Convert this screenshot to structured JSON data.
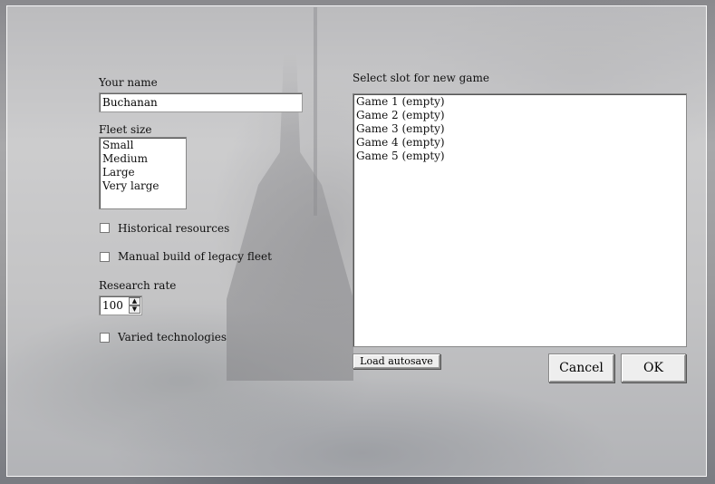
{
  "form": {
    "name_label": "Your name",
    "name_value": "Buchanan",
    "fleet_size_label": "Fleet size",
    "fleet_sizes": [
      "Small",
      "Medium",
      "Large",
      "Very large"
    ],
    "historical_resources_label": "Historical resources",
    "historical_resources_checked": false,
    "manual_build_label": "Manual build of legacy fleet",
    "manual_build_checked": false,
    "research_rate_label": "Research rate",
    "research_rate_value": "100",
    "varied_tech_label": "Varied technologies",
    "varied_tech_checked": false
  },
  "slots": {
    "label": "Select slot for new game",
    "items": [
      "Game 1 (empty)",
      "Game 2 (empty)",
      "Game 3 (empty)",
      "Game 4 (empty)",
      "Game 5 (empty)"
    ]
  },
  "buttons": {
    "load_autosave": "Load autosave",
    "cancel": "Cancel",
    "ok": "OK"
  },
  "icons": {
    "spin_up": "spin-up-arrow-icon",
    "spin_down": "spin-down-arrow-icon"
  }
}
